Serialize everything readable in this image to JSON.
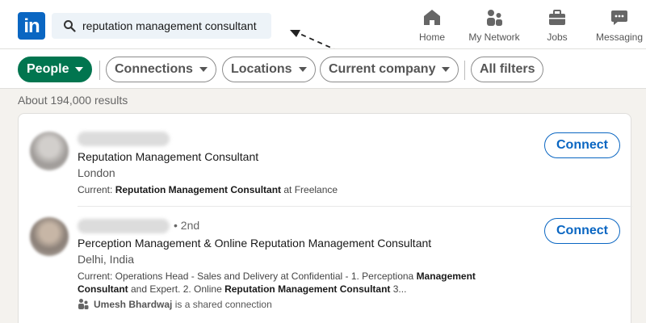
{
  "header": {
    "logo_text": "in",
    "search_value": "reputation management consultant",
    "nav": [
      {
        "label": "Home",
        "icon": "home-icon"
      },
      {
        "label": "My Network",
        "icon": "network-icon"
      },
      {
        "label": "Jobs",
        "icon": "briefcase-icon"
      },
      {
        "label": "Messaging",
        "icon": "messaging-icon"
      }
    ]
  },
  "filters": {
    "people": "People",
    "connections": "Connections",
    "locations": "Locations",
    "current_company": "Current company",
    "all_filters": "All filters"
  },
  "results_count": "About 194,000 results",
  "results": [
    {
      "degree": "",
      "title": "Reputation Management Consultant",
      "location": "London",
      "current_prefix": "Current: ",
      "current_bold": "Reputation Management Consultant",
      "current_suffix": " at Freelance",
      "connect_label": "Connect"
    },
    {
      "degree": "• 2nd",
      "title": "Perception Management & Online Reputation Management Consultant",
      "location": "Delhi, India",
      "current_prefix": "Current: Operations Head - Sales and Delivery at Confidential - 1. Perceptiona ",
      "current_bold_1": "Management",
      "current_bold_2": "Consultant",
      "current_mid": " and Expert. 2. Online ",
      "current_bold_3": "Reputation Management Consultant",
      "current_end": " 3...",
      "shared_name": "Umesh Bhardwaj",
      "shared_text": " is a shared connection",
      "connect_label": "Connect"
    }
  ],
  "colors": {
    "brand": "#0a66c2",
    "active_filter": "#01754f"
  }
}
